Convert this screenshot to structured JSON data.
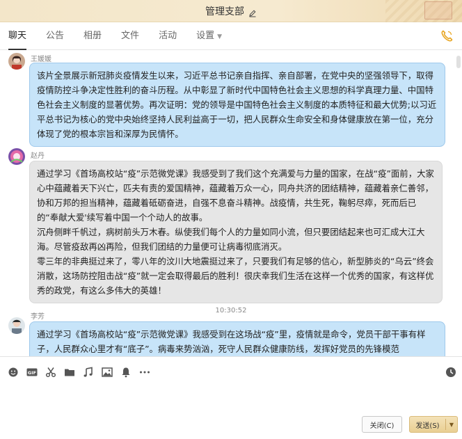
{
  "window": {
    "title": "管理支部"
  },
  "tabs": [
    {
      "label": "聊天"
    },
    {
      "label": "公告"
    },
    {
      "label": "相册"
    },
    {
      "label": "文件"
    },
    {
      "label": "活动"
    },
    {
      "label": "设置"
    }
  ],
  "messages": [
    {
      "sender": "王媛媛",
      "text": "该片全景展示新冠肺炎疫情发生以来，习近平总书记亲自指挥、亲自部署，在党中央的坚强领导下，取得疫情防控斗争决定性胜利的奋斗历程。从中彰显了新时代中国特色社会主义思想的科学真理力量、中国特色社会主义制度的显著优势。再次证明：党的领导是中国特色社会主义制度的本质特征和最大优势;以习近平总书记为核心的党中央始终坚持人民利益高于一切，把人民群众生命安全和身体健康放在第一位，充分体现了党的根本宗旨和深厚为民情怀。"
    },
    {
      "sender": "赵丹",
      "paragraphs": [
        "通过学习《首场高校站“疫”示范微党课》我感受到了我们这个充满爱与力量的国家，在战“疫”面前，大家心中蕴藏着天下兴亡，匹夫有责的爱国精神，蕴藏着万众一心，同舟共济的团结精神，蕴藏着亲仁善邻，协和万邦的担当精神，蕴藏着砥砺奋进，自强不息奋斗精神。战疫情，共生死，鞠躬尽瘁，死而后已的“奉献大爱'续写着中国一个个动人的故事。",
        "沉舟侧畔千帆过，病树前头万木春。纵使我们每个人的力量如同小流，但只要团结起来也可汇成大江大海。尽管疫敌再凶再险，但我们团结的力量便可让病毒彻底消灭。",
        "零三年的非典挺过来了，零八年的汶川大地震挺过来了，只要我们有足够的信心，新型肺炎的“乌云”终会消散，这场防控阻击战“疫”就一定会取得最后的胜利！很庆幸我们生活在这样一个优秀的国家，有这样优秀的政党，有这么多伟大的英雄！"
      ]
    },
    {
      "sender": "李芳",
      "text": "通过学习《首场高校站“疫”示范微党课》我感受到在这场战“疫”里，疫情就是命令，党员干部干事有样子，人民群众心里才有“底子”。病毒来势汹汹，死守人民群众健康防线，发挥好党员的先锋模范"
    }
  ],
  "timestamp": "10:30:52",
  "buttons": {
    "close": "关闭(C)",
    "send": "发送(S)"
  },
  "icons": {
    "toolbar": [
      "emoji-icon",
      "gif-icon",
      "scissors-icon",
      "folder-icon",
      "music-icon",
      "image-icon",
      "bell-icon",
      "more-icon"
    ],
    "accent": "#e8a623"
  }
}
